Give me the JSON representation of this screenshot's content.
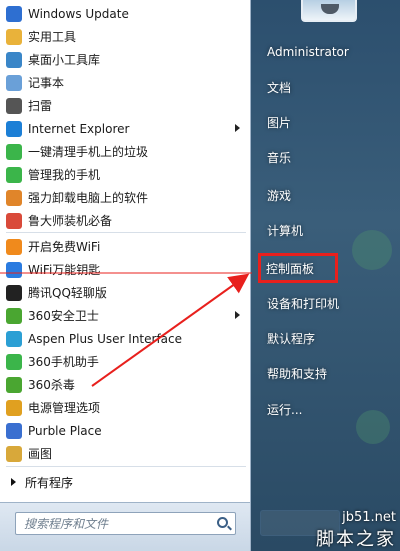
{
  "left_items": [
    {
      "label": "Windows Update",
      "icon": "windows-update-icon",
      "color": "#2e6fd1"
    },
    {
      "label": "实用工具",
      "icon": "folder-icon",
      "color": "#e9b23a"
    },
    {
      "label": "桌面小工具库",
      "icon": "gadgets-icon",
      "color": "#3a86c8"
    },
    {
      "label": "记事本",
      "icon": "notepad-icon",
      "color": "#6aa0d8"
    },
    {
      "label": "扫雷",
      "icon": "minesweeper-icon",
      "color": "#555555"
    },
    {
      "label": "Internet Explorer",
      "icon": "internet-explorer-icon",
      "color": "#1c7fd6",
      "submenu": true
    },
    {
      "label": "一键清理手机上的垃圾",
      "icon": "phone-cleaner-icon",
      "color": "#3bb54a"
    },
    {
      "label": "管理我的手机",
      "icon": "phone-manager-icon",
      "color": "#3bb54a"
    },
    {
      "label": "强力卸载电脑上的软件",
      "icon": "uninstaller-icon",
      "color": "#e0852a"
    },
    {
      "label": "鲁大师装机必备",
      "icon": "ludashi-icon",
      "color": "#d94a3a"
    },
    {
      "label": "开启免费WiFi",
      "icon": "wifi-icon",
      "color": "#f08a1c"
    },
    {
      "label": "WiFi万能钥匙",
      "icon": "wifi-key-icon",
      "color": "#2a7be0"
    },
    {
      "label": "腾讯QQ轻聊版",
      "icon": "qq-penguin-icon",
      "color": "#222222"
    },
    {
      "label": "360安全卫士",
      "icon": "360-safe-icon",
      "color": "#4aa631",
      "submenu": true
    },
    {
      "label": "Aspen Plus User Interface",
      "icon": "aspen-plus-icon",
      "color": "#2b9fd4"
    },
    {
      "label": "360手机助手",
      "icon": "360-phone-icon",
      "color": "#3bb54a"
    },
    {
      "label": "360杀毒",
      "icon": "360-antivirus-icon",
      "color": "#4aa631"
    },
    {
      "label": "电源管理选项",
      "icon": "power-options-icon",
      "color": "#e0a020"
    },
    {
      "label": "Purble Place",
      "icon": "purble-place-icon",
      "color": "#3a6fd0"
    },
    {
      "label": "画图",
      "icon": "paint-icon",
      "color": "#d8a83a"
    }
  ],
  "all_programs": "所有程序",
  "search": {
    "placeholder": "搜索程序和文件"
  },
  "right_items": [
    {
      "label": "Administrator"
    },
    {
      "label": "文档"
    },
    {
      "label": "图片"
    },
    {
      "label": "音乐"
    },
    {
      "label": "游戏"
    },
    {
      "label": "计算机"
    },
    {
      "label": "控制面板",
      "highlight": true
    },
    {
      "label": "设备和打印机"
    },
    {
      "label": "默认程序"
    },
    {
      "label": "帮助和支持"
    },
    {
      "label": "运行..."
    }
  ],
  "watermark": {
    "url": "jb51.net",
    "name": "脚本之家"
  },
  "colors": {
    "highlight": "#e8201d",
    "arrow": "#e8201d"
  }
}
